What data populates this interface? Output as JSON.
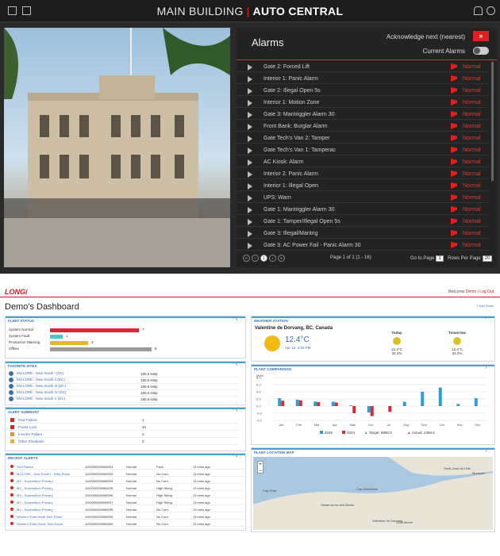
{
  "app": {
    "title_left": "MAIN BUILDING",
    "title_sep": "|",
    "title_right": "AUTO CENTRAL"
  },
  "alarms": {
    "title": "Alarms",
    "acknowledge": "Acknowledge next (nearest)",
    "current_alarms": "Current Alarms",
    "rows": [
      {
        "name": "Gate 2: Forced Lift",
        "status": "Normal"
      },
      {
        "name": "Interior 1: Panic Alarm",
        "status": "Normal"
      },
      {
        "name": "Gate 2: Illegal Open 5s",
        "status": "Normal"
      },
      {
        "name": "Interior 1: Motion Zone",
        "status": "Normal"
      },
      {
        "name": "Gate 3: Mantriggler Alarm 30",
        "status": "Normal"
      },
      {
        "name": "Front Bank: Burglar Alarm",
        "status": "Normal"
      },
      {
        "name": "Gate Tech's Van 2: Tamper",
        "status": "Normal"
      },
      {
        "name": "Gate Tech's Van 1: Tamperac",
        "status": "Normal"
      },
      {
        "name": "AC Kiosk: Alarm",
        "status": "Normal"
      },
      {
        "name": "Interior 2: Panic Alarm",
        "status": "Normal"
      },
      {
        "name": "Interior 1: Illegal Open",
        "status": "Normal"
      },
      {
        "name": "UPS: Warn",
        "status": "Normal"
      },
      {
        "name": "Gate 1: Mantriggler Alarm 30",
        "status": "Normal"
      },
      {
        "name": "Gate 1: Tamper/Illegal Open 5s",
        "status": "Normal"
      },
      {
        "name": "Gate 3: Illegal/Mantrig",
        "status": "Normal"
      },
      {
        "name": "Gate 3: AC Power Fail - Panic Alarm 30",
        "status": "Normal"
      }
    ],
    "pager": {
      "current": "1",
      "page_info": "Page 1 of 1 (1 - 16)",
      "goto": "Go to Page",
      "goto_val": "1",
      "rows_per_page": "Rows Per Page",
      "rows_val": "20"
    }
  },
  "dashboard": {
    "logo": "LONGi",
    "welcome": "Welcome",
    "user": "Demo",
    "logout": "Log Out",
    "title": "Demo's Dashboard",
    "add_panel": "+ Add Panel",
    "fleet": {
      "title": "FLEET STATUS",
      "rows": [
        {
          "label": "System Normal",
          "value": "7"
        },
        {
          "label": "System Fault",
          "value": "1"
        },
        {
          "label": "Production Warning",
          "value": "3"
        },
        {
          "label": "Offline",
          "value": "8"
        }
      ]
    },
    "favorites": {
      "title": "FAVORITE SITES",
      "rows": [
        {
          "name": "MV-LORE - New South I (DC)",
          "value": "190.6 kWp"
        },
        {
          "name": "MV-LORE - New South II (DC)",
          "value": "190.6 kWp"
        },
        {
          "name": "MV-LORE - New South III (DC)",
          "value": "190.6 kWp"
        },
        {
          "name": "MV-LORE - New South IV (DC)",
          "value": "190.6 kWp"
        },
        {
          "name": "MV-LORE - New South V (DC)",
          "value": "190.6 kWp"
        }
      ]
    },
    "alert_summary": {
      "title": "ALERT SUMMARY",
      "rows": [
        {
          "label": "Grid Failure",
          "value": "1"
        },
        {
          "label": "Power Loss",
          "value": "10"
        },
        {
          "label": "Inverter Failure",
          "value": "2"
        },
        {
          "label": "Other Shutdown",
          "value": "2"
        }
      ]
    },
    "recent": {
      "title": "RECENT ALERTS",
      "rows": [
        [
          "Grid Failure",
          "1100000000068004",
          "Normal",
          "Fault",
          "13 mins ago"
        ],
        [
          "MV-LORE - New South I - Main Room",
          "1100000000068293",
          "Normal",
          "No Com.",
          "13 mins ago"
        ],
        [
          "MV - Superstition Primary",
          "1100000000068294",
          "Normal",
          "No Com.",
          "13 mins ago"
        ],
        [
          "MV - Superstition Primary",
          "1100000000068295",
          "Normal",
          "High String",
          "13 mins ago"
        ],
        [
          "MV - Superstition Primary",
          "1100000000068296",
          "Normal",
          "High String",
          "13 mins ago"
        ],
        [
          "MV - Superstition Primary",
          "1100000000068297",
          "Normal",
          "High String",
          "13 mins ago"
        ],
        [
          "MV - Superstition Primary",
          "1100000000068298",
          "Normal",
          "No Com.",
          "13 mins ago"
        ],
        [
          "Western Solar North Tech Room",
          "1100000000068299",
          "Normal",
          "No Com.",
          "13 mins ago"
        ],
        [
          "Western Solar South Tech Room",
          "1100000000068300",
          "Normal",
          "No Com.",
          "13 mins ago"
        ]
      ]
    },
    "weather": {
      "title": "WEATHER STATION",
      "location": "Valentine de Dorvang, BC, Canada",
      "temp": "12.4°C",
      "date": "Apr 12, 4:20 PM",
      "today": "Today",
      "tomorrow": "Tomorrow",
      "today_t": "12.4°C",
      "today_h": "34.2%",
      "tom_t": "12.4°C",
      "tom_h": "34.2%"
    },
    "plant": {
      "title": "PLANT COMPARISON",
      "unit": "MWh"
    },
    "map": {
      "title": "PLANT LOCATION MAP",
      "labels": [
        "Cap-Chat",
        "Sainte-Anne-des-Monts",
        "Cap-Madeleine",
        "Valentine de Dorvang",
        "Saint-Jean-de-l'Isle",
        "Murdoch",
        "Gros-Morne"
      ]
    }
  },
  "chart_data": {
    "type": "bar",
    "categories": [
      "Jan",
      "Feb",
      "Mar",
      "Apr",
      "May",
      "Jun",
      "Jul",
      "Aug",
      "Sep",
      "Oct",
      "Nov",
      "Dec"
    ],
    "ylim": [
      -4,
      8
    ],
    "yticks": [
      "8.0",
      "6.0",
      "4.0",
      "2.0",
      "0.0",
      "-2.0",
      "-4.0"
    ],
    "series": [
      {
        "name": "2025",
        "color": "#2a9fd6",
        "values": [
          2.2,
          1.8,
          1.3,
          1.2,
          0.2,
          -1.8,
          null,
          1.2,
          4.0,
          5.2,
          0.6,
          2.2
        ]
      },
      {
        "name": "2024",
        "color": "#d62a3a",
        "values": [
          1.5,
          1.6,
          1.1,
          1.0,
          -2.0,
          -2.8,
          -1.6,
          null,
          null,
          null,
          null,
          null
        ]
      }
    ],
    "legend_extra": [
      "Target: 5980.0",
      "Actual: 2458.5"
    ]
  }
}
